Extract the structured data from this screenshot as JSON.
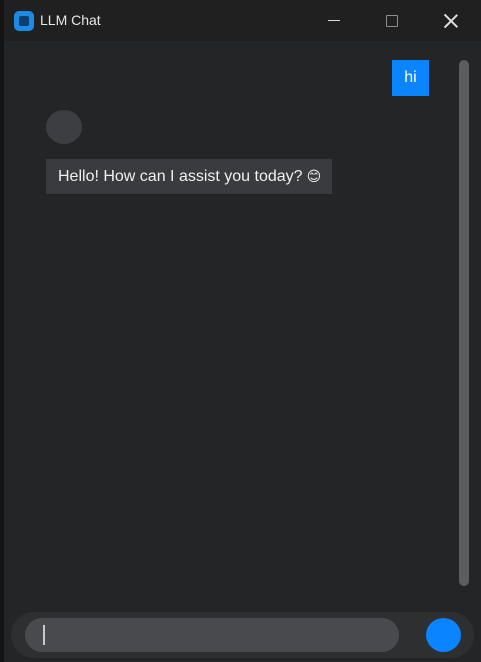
{
  "window": {
    "title": "LLM Chat"
  },
  "messages": [
    {
      "role": "user",
      "text": "hi"
    },
    {
      "role": "assistant",
      "text": "Hello! How can I assist you today?",
      "emoji": "😊"
    }
  ],
  "composer": {
    "value": "",
    "placeholder": ""
  },
  "colors": {
    "accent": "#0a84ff",
    "window_bg": "#242527",
    "titlebar_bg": "#202020",
    "assistant_bubble": "#3a3b3e"
  },
  "icons": {
    "app": "app-icon",
    "minimize": "minimize-icon",
    "maximize": "maximize-icon",
    "close": "close-icon"
  }
}
